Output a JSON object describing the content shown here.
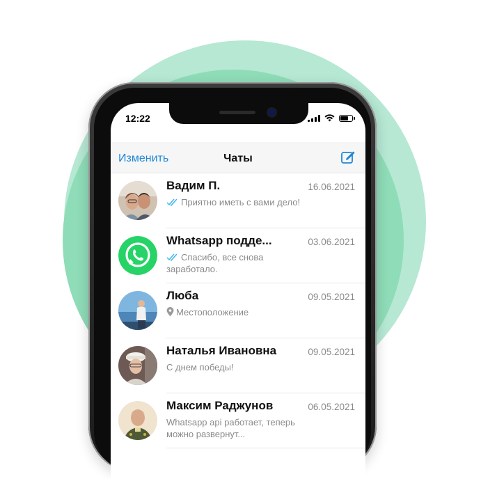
{
  "status_bar": {
    "time": "12:22",
    "battery_level": 0.7
  },
  "navbar": {
    "edit_label": "Изменить",
    "title": "Чаты",
    "compose_icon": "compose-icon"
  },
  "colors": {
    "accent": "#1f87d6",
    "whatsapp_green": "#25d366",
    "read_ticks": "#34b7f1",
    "muted_text": "#8a8a8a"
  },
  "chats": [
    {
      "name": "Вадим П.",
      "date": "16.06.2021",
      "preview": "Приятно иметь с вами дело!",
      "status_icon": "double-check-icon"
    },
    {
      "name": "Whatsapp подде...",
      "date": "03.06.2021",
      "preview": "Спасибо, все снова заработало.",
      "status_icon": "double-check-icon"
    },
    {
      "name": "Люба",
      "date": "09.05.2021",
      "preview": "Местоположение",
      "status_icon": "location-pin-icon"
    },
    {
      "name": "Наталья Ивановна",
      "date": "09.05.2021",
      "preview": "С днем победы!",
      "status_icon": ""
    },
    {
      "name": "Максим Раджунов",
      "date": "06.05.2021",
      "preview": "Whatsapp api работает, теперь можно развернут...",
      "status_icon": ""
    }
  ]
}
